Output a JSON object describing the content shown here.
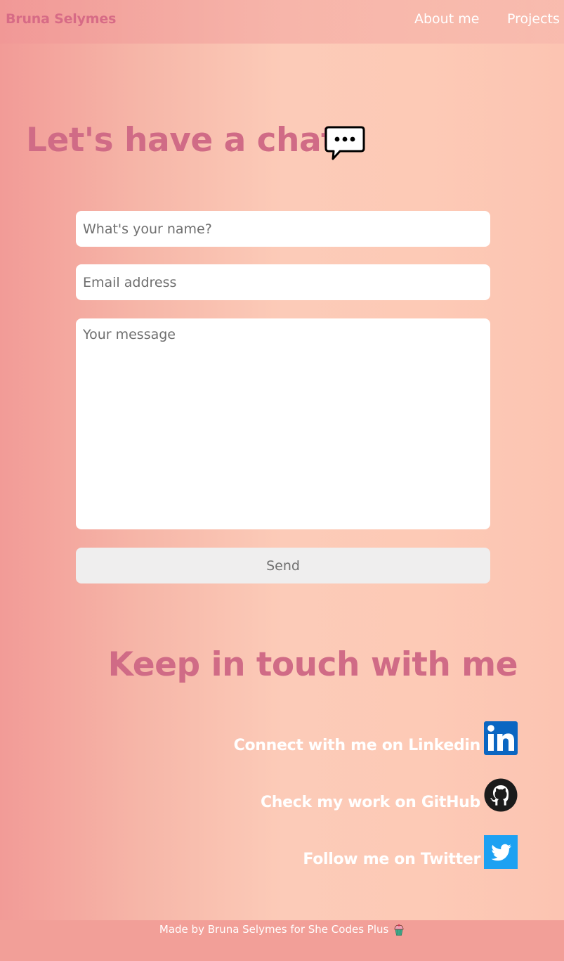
{
  "navbar": {
    "brand": "Bruna Selymes",
    "links": [
      {
        "label": "About me"
      },
      {
        "label": "Projects"
      }
    ]
  },
  "contact": {
    "title": "Let's have a chat",
    "title_icon": "speech-bubble-icon",
    "name_placeholder": "What's your name?",
    "email_placeholder": "Email address",
    "message_placeholder": "Your message",
    "send_label": "Send"
  },
  "social": {
    "title": "Keep in touch with me",
    "items": [
      {
        "label": "Connect with me on Linkedin",
        "icon": "linkedin-icon",
        "color": "#0a66c2"
      },
      {
        "label": "Check my work on GitHub",
        "icon": "github-icon",
        "color": "#000000"
      },
      {
        "label": "Follow me on Twitter",
        "icon": "twitter-icon",
        "color": "#1da1f2"
      }
    ]
  },
  "footer": {
    "text": "Made by Bruna Selymes for She Codes Plus",
    "icon": "cupcake-icon"
  },
  "colors": {
    "accent": "#d06b86",
    "nav_text": "#ffffff",
    "footer_bg": "#f29f98"
  }
}
